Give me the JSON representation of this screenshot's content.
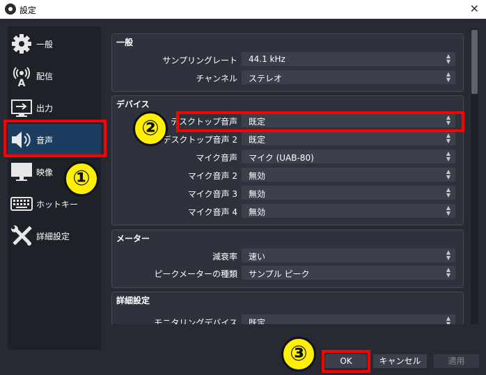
{
  "window": {
    "title": "設定",
    "close_glyph": "✕"
  },
  "sidebar": {
    "items": [
      {
        "label": "一般",
        "icon": "gear-icon"
      },
      {
        "label": "配信",
        "icon": "broadcast-icon"
      },
      {
        "label": "出力",
        "icon": "output-icon"
      },
      {
        "label": "音声",
        "icon": "speaker-icon",
        "active": true
      },
      {
        "label": "映像",
        "icon": "monitor-icon"
      },
      {
        "label": "ホットキー",
        "icon": "keyboard-icon"
      },
      {
        "label": "詳細設定",
        "icon": "tools-icon"
      }
    ]
  },
  "general": {
    "title": "一般",
    "rows": [
      {
        "label": "サンプリングレート",
        "value": "44.1 kHz"
      },
      {
        "label": "チャンネル",
        "value": "ステレオ"
      }
    ]
  },
  "devices": {
    "title": "デバイス",
    "rows": [
      {
        "label": "デスクトップ音声",
        "value": "既定"
      },
      {
        "label": "デスクトップ音声 2",
        "value": "既定"
      },
      {
        "label": "マイク音声",
        "value": "マイク (UAB-80)"
      },
      {
        "label": "マイク音声 2",
        "value": "無効"
      },
      {
        "label": "マイク音声 3",
        "value": "無効"
      },
      {
        "label": "マイク音声 4",
        "value": "無効"
      }
    ]
  },
  "meters": {
    "title": "メーター",
    "rows": [
      {
        "label": "減衰率",
        "value": "速い"
      },
      {
        "label": "ピークメーターの種類",
        "value": "サンプル ピーク"
      }
    ]
  },
  "advanced": {
    "title": "詳細設定",
    "rows": [
      {
        "label": "モニタリングデバイス",
        "value": "既定"
      }
    ]
  },
  "buttons": {
    "ok": "OK",
    "cancel": "キャンセル",
    "apply": "適用"
  },
  "annotations": {
    "one": "①",
    "two": "②",
    "three": "③"
  },
  "colors": {
    "highlight": "#ff0000",
    "marker": "#ffef00",
    "active_item": "#1b3e60"
  }
}
